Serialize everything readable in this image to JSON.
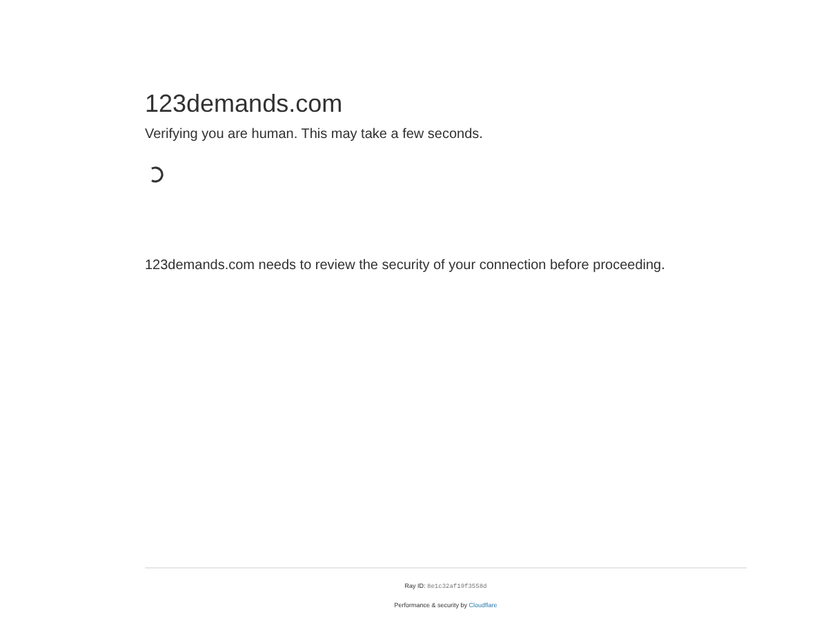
{
  "site": {
    "title": "123demands.com",
    "status": "Verifying you are human. This may take a few seconds.",
    "loading": true
  },
  "message": "123demands.com needs to review the security of your connection before proceeding.",
  "footer": {
    "ray_label": "Ray ID:",
    "ray_id": "8e1c32af19f3558d",
    "performance": "Performance & security by",
    "provider": "Cloudflare"
  }
}
